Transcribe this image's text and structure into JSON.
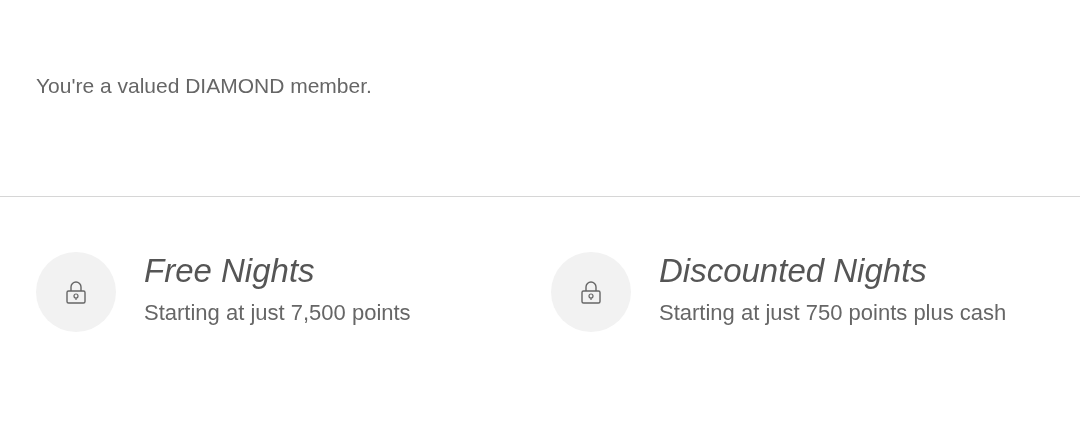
{
  "member_status": "You're a valued DIAMOND member.",
  "benefits": [
    {
      "title": "Free Nights",
      "subtitle": "Starting at just 7,500 points",
      "locked": true
    },
    {
      "title": "Discounted Nights",
      "subtitle": "Starting at just 750 points plus cash",
      "locked": true
    }
  ]
}
